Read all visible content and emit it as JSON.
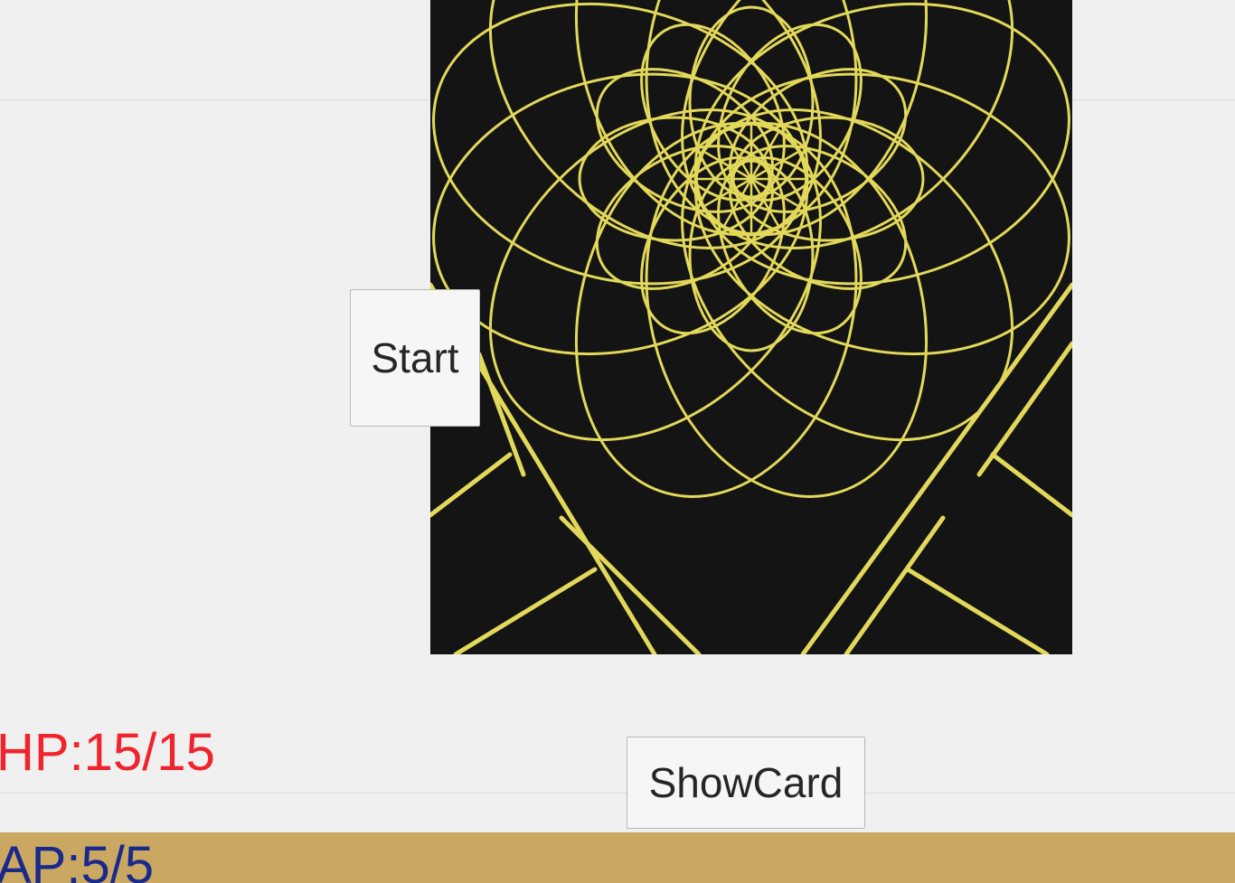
{
  "buttons": {
    "start_label": "Start",
    "showcard_label": "ShowCard"
  },
  "stats": {
    "hp": "HP:15/15",
    "ap": "AP:5/5"
  },
  "colors": {
    "background": "#f0f0f0",
    "card_back": "#141414",
    "card_pattern": "#e2d85a",
    "hp_text": "#f0242c",
    "ap_text": "#1a2a8c",
    "ap_bar": "#caa862"
  },
  "icons": {
    "card_pattern": "spirograph-rosette-icon"
  }
}
